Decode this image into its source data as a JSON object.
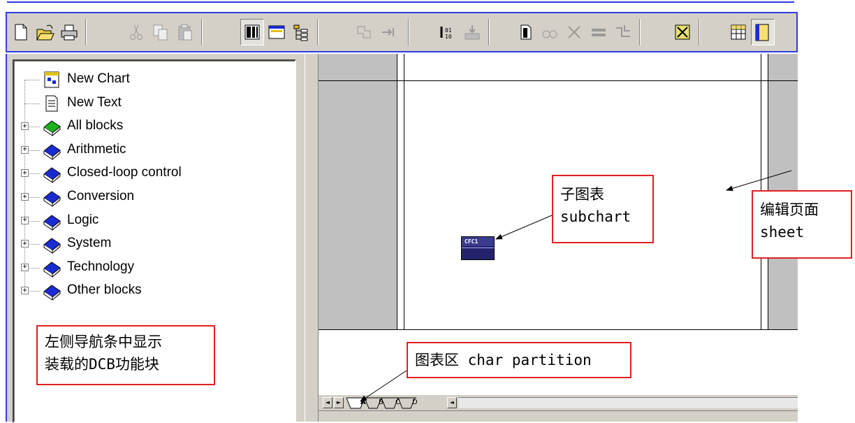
{
  "toolbar": {
    "buttons": [
      {
        "name": "new-icon"
      },
      {
        "name": "open-folder-icon"
      },
      {
        "name": "print-icon"
      },
      {
        "name": "cut-icon"
      },
      {
        "name": "copy-icon"
      },
      {
        "name": "paste-icon"
      },
      {
        "name": "catalog-icon"
      },
      {
        "name": "overview-icon"
      },
      {
        "name": "chart-tree-icon"
      },
      {
        "name": "interconnect-icon"
      },
      {
        "name": "connect-icon"
      },
      {
        "name": "compile-icon"
      },
      {
        "name": "download-icon"
      },
      {
        "name": "test-mode-icon"
      },
      {
        "name": "watch-icon"
      },
      {
        "name": "delete-connection-icon"
      },
      {
        "name": "align-icon"
      },
      {
        "name": "route-icon"
      },
      {
        "name": "zoom-fit-icon"
      },
      {
        "name": "table-view-icon"
      },
      {
        "name": "sheet-view-icon"
      }
    ]
  },
  "nav": {
    "items": [
      {
        "label": "New Chart",
        "icon": "new-chart-icon",
        "expandable": false
      },
      {
        "label": "New Text",
        "icon": "new-text-icon",
        "expandable": false
      },
      {
        "label": "All blocks",
        "icon": "green-book-icon",
        "expandable": true
      },
      {
        "label": "Arithmetic",
        "icon": "book-icon",
        "expandable": true
      },
      {
        "label": "Closed-loop control",
        "icon": "book-icon",
        "expandable": true
      },
      {
        "label": "Conversion",
        "icon": "book-icon",
        "expandable": true
      },
      {
        "label": "Logic",
        "icon": "book-icon",
        "expandable": true
      },
      {
        "label": "System",
        "icon": "book-icon",
        "expandable": true
      },
      {
        "label": "Technology",
        "icon": "book-icon",
        "expandable": true
      },
      {
        "label": "Other blocks",
        "icon": "book-icon",
        "expandable": true
      }
    ],
    "expander_symbol": "+"
  },
  "chart": {
    "subchart_label": "CFC1"
  },
  "tabs": {
    "sheets": [
      "A",
      "B",
      "C",
      "D"
    ],
    "active": "A",
    "nav_first": "◄",
    "nav_last": "►",
    "scroll_left": "◄"
  },
  "annotations": {
    "nav_note_line1": "左侧导航条中显示",
    "nav_note_line2": "装载的DCB功能块",
    "subchart_line1": "子图表",
    "subchart_line2": "subchart",
    "sheet_line1": "编辑页面",
    "sheet_line2": "sheet",
    "partition": "图表区 char partition"
  },
  "colors": {
    "frame_blue": "#2f3ce0",
    "annotation_red": "#e02020",
    "book_blue": "#1a2bd1",
    "book_green": "#1db31d"
  }
}
